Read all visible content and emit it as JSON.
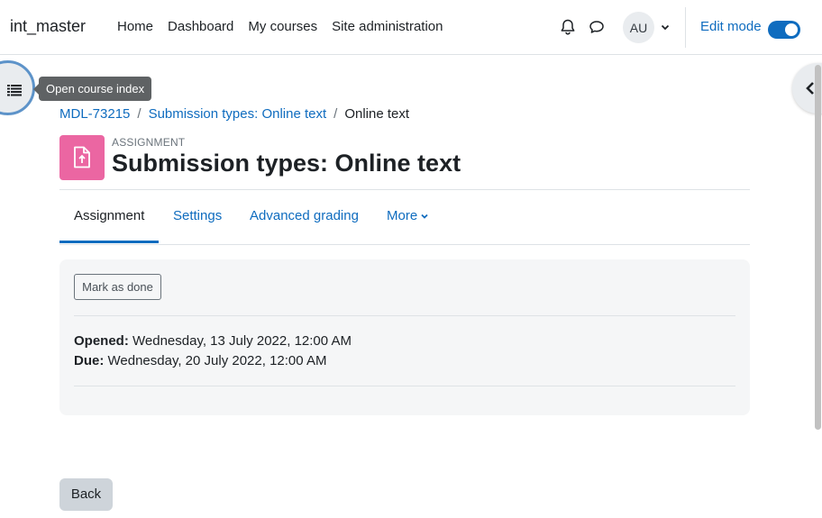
{
  "navbar": {
    "brand": "int_master",
    "links": [
      "Home",
      "Dashboard",
      "My courses",
      "Site administration"
    ],
    "avatar_initials": "AU",
    "edit_mode_label": "Edit mode",
    "edit_mode_on": true,
    "icons": {
      "notifications": "bell-icon",
      "messages": "chat-bubble-icon",
      "user_menu": "chevron-down-icon"
    }
  },
  "course_index": {
    "icon": "list-icon",
    "tooltip": "Open course index"
  },
  "drawer": {
    "icon": "chevron-left-icon"
  },
  "breadcrumb": {
    "items": [
      "MDL-73215",
      "Submission types: Online text",
      "Online text"
    ],
    "separator": "/"
  },
  "header": {
    "activity_type": "ASSIGNMENT",
    "title": "Submission types: Online text",
    "icon": "assignment-icon",
    "icon_color": "#eb66a2"
  },
  "tabs": [
    {
      "label": "Assignment",
      "active": true
    },
    {
      "label": "Settings",
      "active": false
    },
    {
      "label": "Advanced grading",
      "active": false
    },
    {
      "label": "More",
      "active": false
    }
  ],
  "activity_info": {
    "mark_done_label": "Mark as done",
    "opened_label": "Opened:",
    "opened_value": "Wednesday, 13 July 2022, 12:00 AM",
    "due_label": "Due:",
    "due_value": "Wednesday, 20 July 2022, 12:00 AM"
  },
  "footer": {
    "back_label": "Back"
  },
  "colors": {
    "accent": "#0f6cbf",
    "text": "#1d2125",
    "muted": "#6a737b"
  }
}
